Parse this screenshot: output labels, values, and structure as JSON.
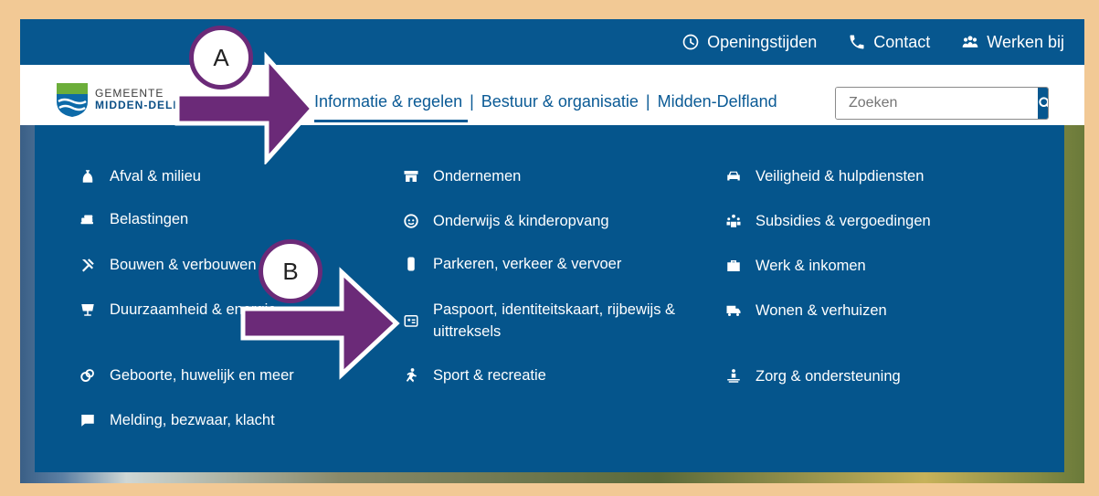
{
  "utility_nav": [
    {
      "label": "Openingstijden",
      "icon": "clock-icon"
    },
    {
      "label": "Contact",
      "icon": "phone-icon"
    },
    {
      "label": "Werken bij",
      "icon": "people-icon"
    }
  ],
  "logo": {
    "line1": "GEMEENTE",
    "line2": "MIDDEN-DELFLAND"
  },
  "main_nav": [
    {
      "label": "Informatie & regelen",
      "active": true
    },
    {
      "label": "Bestuur & organisatie",
      "active": false
    },
    {
      "label": "Midden-Delfland",
      "active": false
    }
  ],
  "search": {
    "placeholder": "Zoeken"
  },
  "menu": {
    "col1": [
      {
        "label": "Afval & milieu",
        "icon": "waste-bag-icon"
      },
      {
        "label": "Belastingen",
        "icon": "money-icon"
      },
      {
        "label": "Bouwen & verbouwen",
        "icon": "tools-icon"
      },
      {
        "label": "Duurzaamheid & energie",
        "icon": "solar-panel-icon"
      },
      {
        "label": "Geboorte, huwelijk en meer",
        "icon": "rings-icon"
      },
      {
        "label": "Melding, bezwaar, klacht",
        "icon": "message-icon"
      }
    ],
    "col2": [
      {
        "label": "Ondernemen",
        "icon": "shop-icon"
      },
      {
        "label": "Onderwijs & kinderopvang",
        "icon": "child-face-icon"
      },
      {
        "label": "Parkeren, verkeer & vervoer",
        "icon": "traffic-light-icon"
      },
      {
        "label": "Paspoort, identiteitskaart, rijbewijs & uittreksels",
        "icon": "id-card-icon"
      },
      {
        "label": "Sport & recreatie",
        "icon": "running-icon"
      }
    ],
    "col3": [
      {
        "label": "Veiligheid & hulpdiensten",
        "icon": "car-icon"
      },
      {
        "label": "Subsidies & vergoedingen",
        "icon": "group-icon"
      },
      {
        "label": "Werk & inkomen",
        "icon": "briefcase-icon"
      },
      {
        "label": "Wonen & verhuizen",
        "icon": "moving-truck-icon"
      },
      {
        "label": "Zorg & ondersteuning",
        "icon": "care-icon"
      }
    ]
  },
  "annotations": [
    {
      "label": "A"
    },
    {
      "label": "B"
    }
  ],
  "colors": {
    "brand": "#07578f",
    "menu_bg": "#05558c",
    "frame": "#f2c995",
    "arrow": "#6b2a78"
  }
}
